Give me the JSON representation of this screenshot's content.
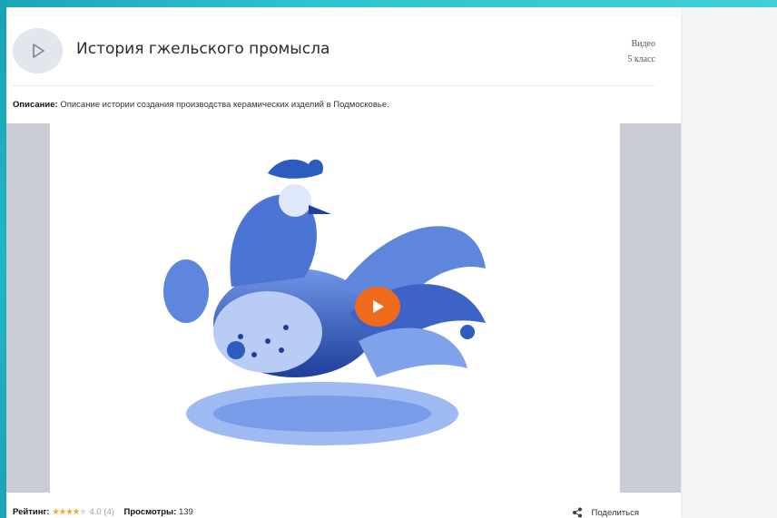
{
  "header": {
    "title": "История гжельского промысла",
    "type": "Видео",
    "grade": "5 класс"
  },
  "description": {
    "label": "Описание:",
    "text": "Описание истории создания производства керамических изделий в Подмосковье."
  },
  "video": {
    "image_subject": "Гжель — петух (иллюстрация)"
  },
  "footer": {
    "rating_label": "Рейтинг:",
    "rating_value": "4.0",
    "rating_count": "(4)",
    "views_label": "Просмотры:",
    "views_value": "139",
    "share_label": "Поделиться"
  },
  "colors": {
    "accent_orange": "#f06a1c",
    "teal": "#1aa6b7",
    "gzhel_blue": "#2e5bbf"
  },
  "icons": {
    "header_play": "play-icon",
    "video_play": "play-icon",
    "share": "share-icon"
  }
}
